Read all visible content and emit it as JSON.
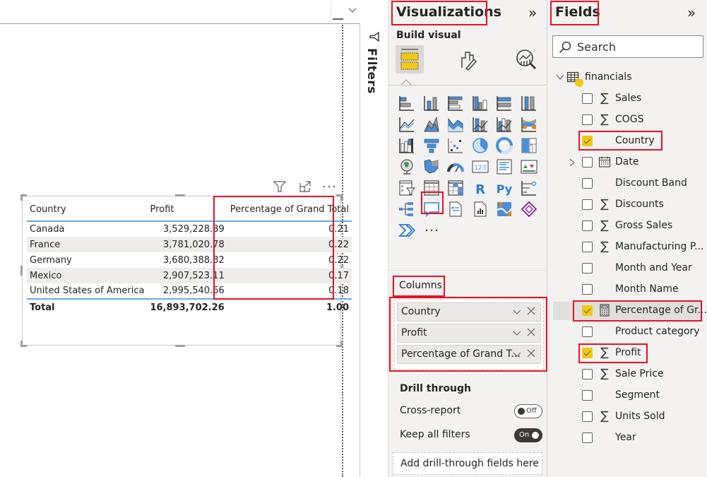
{
  "canvas": {
    "visual_header_icons": [
      "filter-icon",
      "focus-mode-icon",
      "more-options-icon"
    ],
    "table": {
      "columns": [
        "Country",
        "Profit",
        "Percentage of Grand Total"
      ],
      "rows": [
        {
          "country": "Canada",
          "profit": "3,529,228.89",
          "pct": "0.21"
        },
        {
          "country": "France",
          "profit": "3,781,020.78",
          "pct": "0.22"
        },
        {
          "country": "Germany",
          "profit": "3,680,388.82",
          "pct": "0.22"
        },
        {
          "country": "Mexico",
          "profit": "2,907,523.11",
          "pct": "0.17"
        },
        {
          "country": "United States of America",
          "profit": "2,995,540.66",
          "pct": "0.18"
        }
      ],
      "total": {
        "label": "Total",
        "profit": "16,893,702.26",
        "pct": "1.00"
      }
    }
  },
  "filters": {
    "label": "Filters"
  },
  "visualizations": {
    "title": "Visualizations",
    "collapse_glyph": "»",
    "build_visual_label": "Build visual",
    "build_tabs": [
      "build-visual-tab",
      "format-visual-tab",
      "analytics-tab"
    ],
    "visual_types": [
      "stacked-bar-chart",
      "stacked-column-chart",
      "clustered-bar-chart",
      "clustered-column-chart",
      "100-stacked-bar-chart",
      "100-stacked-column-chart",
      "line-chart",
      "area-chart",
      "stacked-area-chart",
      "line-and-stacked-column-chart",
      "line-and-clustered-column-chart",
      "ribbon-chart",
      "waterfall-chart",
      "funnel-chart",
      "scatter-chart",
      "pie-chart",
      "donut-chart",
      "treemap",
      "map",
      "filled-map",
      "gauge",
      "card",
      "multi-row-card",
      "kpi",
      "slicer",
      "table",
      "matrix",
      "r-script-visual",
      "python-visual",
      "key-influencers",
      "decomposition-tree",
      "q-and-a",
      "smart-narrative",
      "paginated-report",
      "azure-map",
      "power-apps",
      "power-automate",
      "more-visuals"
    ],
    "selected_visual": "table",
    "columns_label": "Columns",
    "columns": [
      {
        "label": "Country"
      },
      {
        "label": "Profit"
      },
      {
        "label": "Percentage of Grand T..."
      }
    ],
    "drill_through": {
      "title": "Drill through",
      "cross_report_label": "Cross-report",
      "cross_report_state": "Off",
      "keep_filters_label": "Keep all filters",
      "keep_filters_state": "On",
      "drop_placeholder": "Add drill-through fields here"
    }
  },
  "fields": {
    "title": "Fields",
    "collapse_glyph": "»",
    "search_placeholder": "Search",
    "table_name": "financials",
    "items": [
      {
        "name": "Sales",
        "icon": "sigma",
        "checked": false
      },
      {
        "name": "COGS",
        "icon": "sigma",
        "checked": false
      },
      {
        "name": "Country",
        "icon": "",
        "checked": true
      },
      {
        "name": "Date",
        "icon": "calendar",
        "checked": false,
        "expandable": true
      },
      {
        "name": "Discount Band",
        "icon": "",
        "checked": false
      },
      {
        "name": "Discounts",
        "icon": "sigma",
        "checked": false
      },
      {
        "name": "Gross Sales",
        "icon": "sigma",
        "checked": false
      },
      {
        "name": "Manufacturing P...",
        "icon": "sigma",
        "checked": false
      },
      {
        "name": "Month and Year",
        "icon": "",
        "checked": false
      },
      {
        "name": "Month Name",
        "icon": "",
        "checked": false
      },
      {
        "name": "Percentage of Gr...",
        "icon": "calculator",
        "checked": true,
        "highlight": true
      },
      {
        "name": "Product category",
        "icon": "",
        "checked": false
      },
      {
        "name": "Profit",
        "icon": "sigma",
        "checked": true
      },
      {
        "name": "Sale Price",
        "icon": "sigma",
        "checked": false
      },
      {
        "name": "Segment",
        "icon": "",
        "checked": false
      },
      {
        "name": "Units Sold",
        "icon": "sigma",
        "checked": false
      },
      {
        "name": "Year",
        "icon": "",
        "checked": false
      }
    ]
  },
  "colors": {
    "annotation_red": "#e81123",
    "powerbi_yellow": "#f2c811",
    "accent_blue": "#69a9e6",
    "pane_bg": "#f3f2f1"
  }
}
